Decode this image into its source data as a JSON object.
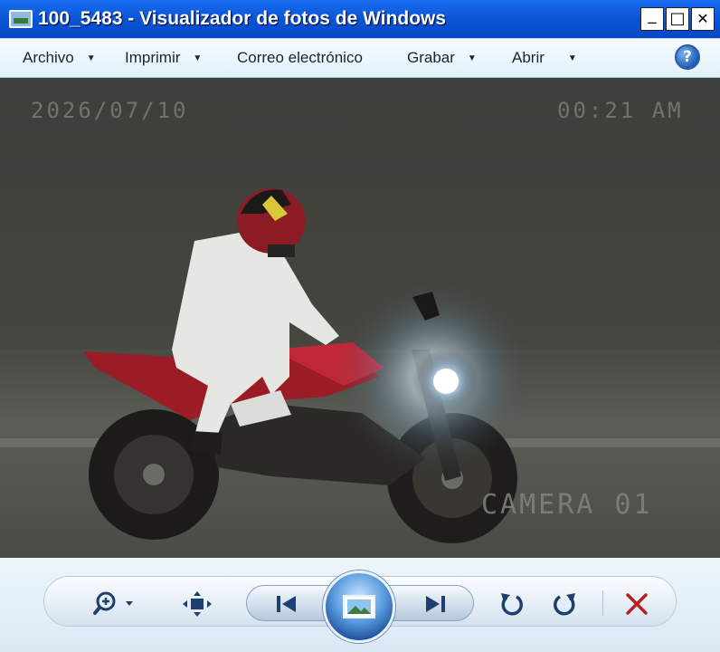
{
  "window": {
    "title": "100_5483 - Visualizador de fotos de Windows",
    "controls": {
      "minimize": "_",
      "maximize": "□",
      "close": "✕"
    }
  },
  "menu": {
    "items": [
      {
        "label": "Archivo",
        "has_dropdown": true
      },
      {
        "label": "Imprimir",
        "has_dropdown": true
      },
      {
        "label": "Correo electrónico",
        "has_dropdown": false
      },
      {
        "label": "Grabar",
        "has_dropdown": true
      },
      {
        "label": "Abrir",
        "has_dropdown": true
      }
    ],
    "help_label": "?"
  },
  "photo": {
    "date_overlay": "2026/07/10",
    "time_overlay": "00:21 AM",
    "camera_overlay": "CAMERA 01"
  },
  "toolbar": {
    "buttons": [
      "zoom-icon",
      "fit-to-window-icon",
      "previous-icon",
      "slideshow-icon",
      "next-icon",
      "rotate-counterclockwise-icon",
      "rotate-clockwise-icon",
      "delete-icon"
    ],
    "colors": {
      "icon": "#1f3f6e",
      "delete": "#b82020",
      "accent": "#3f86d8"
    }
  }
}
